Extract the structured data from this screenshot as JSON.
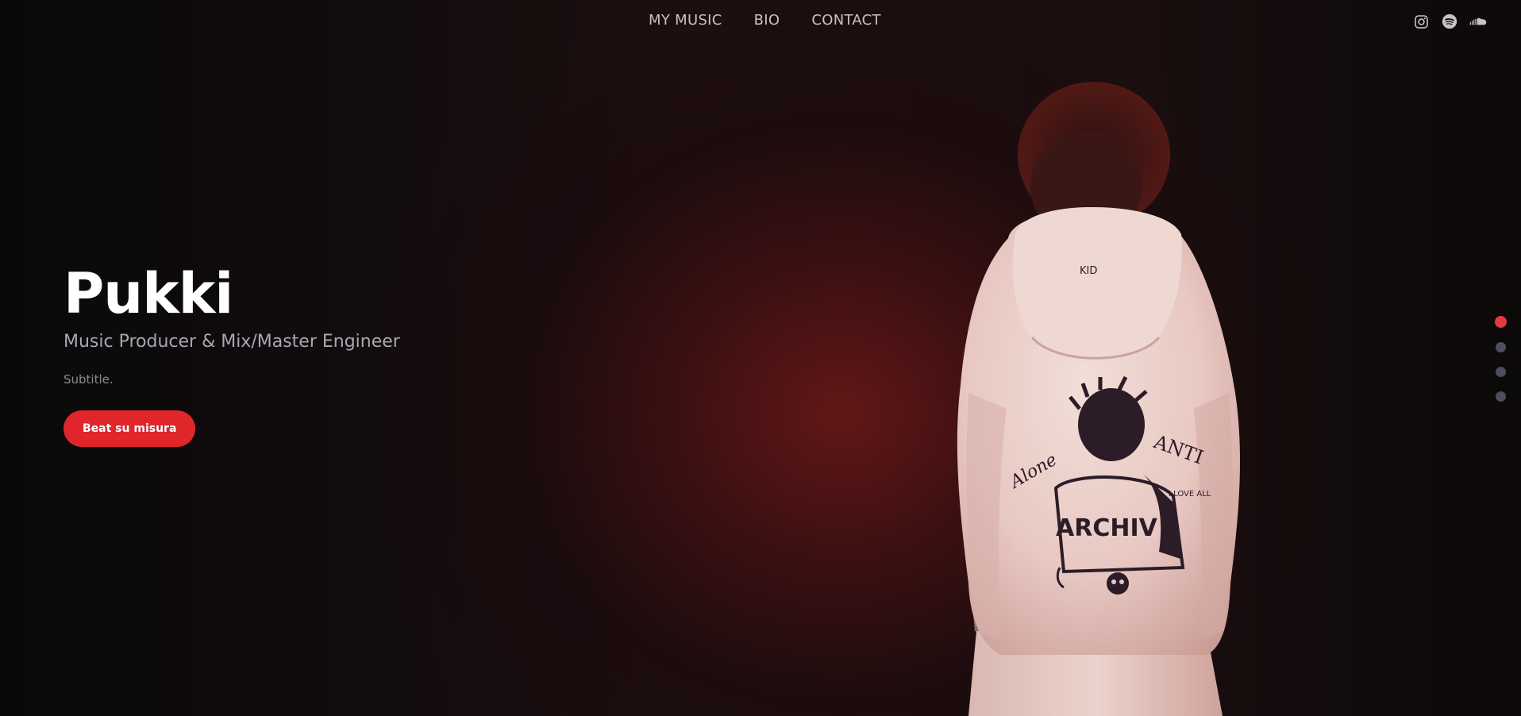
{
  "nav": {
    "links": [
      "MY MUSIC",
      "BIO",
      "CONTACT"
    ]
  },
  "socials": [
    {
      "icon": "instagram-icon"
    },
    {
      "icon": "spotify-icon"
    },
    {
      "icon": "soundcloud-icon"
    }
  ],
  "hero": {
    "title": "Pukki",
    "subtitle": "Music Producer & Mix/Master Engineer",
    "tagline": "Subtitle.",
    "cta_label": "Beat su misura"
  },
  "hoodie_print": {
    "text_main": "ARCHIV",
    "text_left": "Alone",
    "text_right": "ANTI",
    "text_small": "I LOVE ALL",
    "hood_tag": "KID"
  },
  "colors": {
    "accent": "#e0262b",
    "dot_active": "#e33a3f",
    "dot_inactive": "#4b4f5c",
    "background": "#0b0809"
  },
  "section_dots": {
    "count": 4,
    "active_index": 0
  }
}
